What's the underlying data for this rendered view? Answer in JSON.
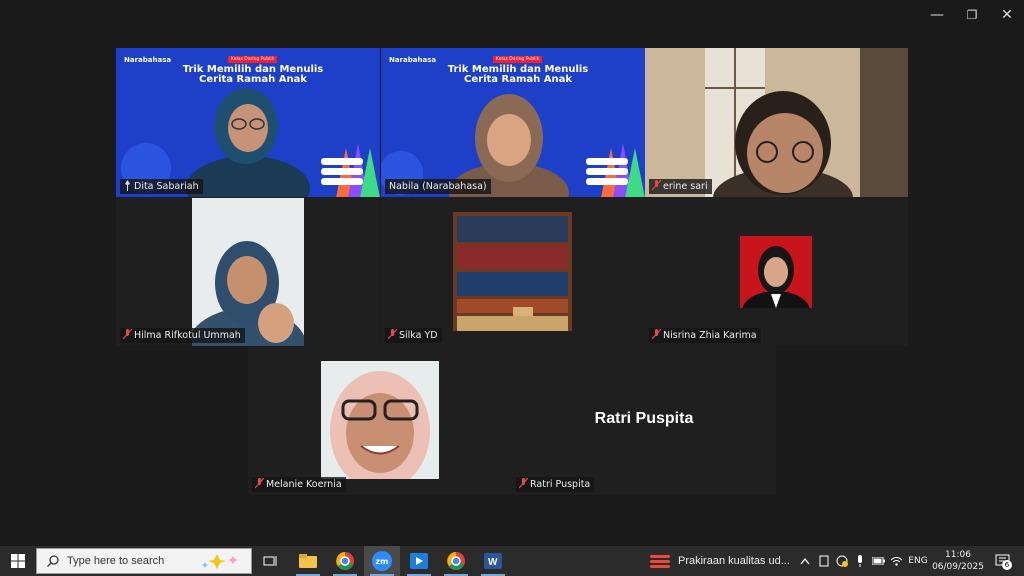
{
  "window": {
    "controls": {
      "minimize": "—",
      "restore": "❐",
      "close": "✕"
    }
  },
  "participants": [
    {
      "name": "Dita Sabariah",
      "active": true
    },
    {
      "name": "Nabila (Narabahasa)"
    },
    {
      "name": "erine sari"
    },
    {
      "name": "Hilma Rifkotul Ummah"
    },
    {
      "name": "Silka YD"
    },
    {
      "name": "Nisrina Zhia Karima"
    },
    {
      "name": "Melanie Koernia"
    },
    {
      "name": "Ratri Puspita",
      "display_name": "Ratri Puspita"
    }
  ],
  "slide": {
    "brand": "Narabahasa",
    "tag": "Kelas Daring Publik",
    "title_line1": "Trik Memilih dan Menulis",
    "title_line2": "Cerita Ramah Anak"
  },
  "taskbar": {
    "search_placeholder": "Type here to search",
    "weather_text": "Prakiraan kualitas ud...",
    "language": "ENG",
    "time": "11:06",
    "date": "06/09/2025",
    "notification_count": "6",
    "zoom_label": "zm"
  },
  "colors": {
    "active_border": "#3ddc84",
    "slide_blue": "#1e40c8",
    "taskbar": "#2b2b2b"
  }
}
